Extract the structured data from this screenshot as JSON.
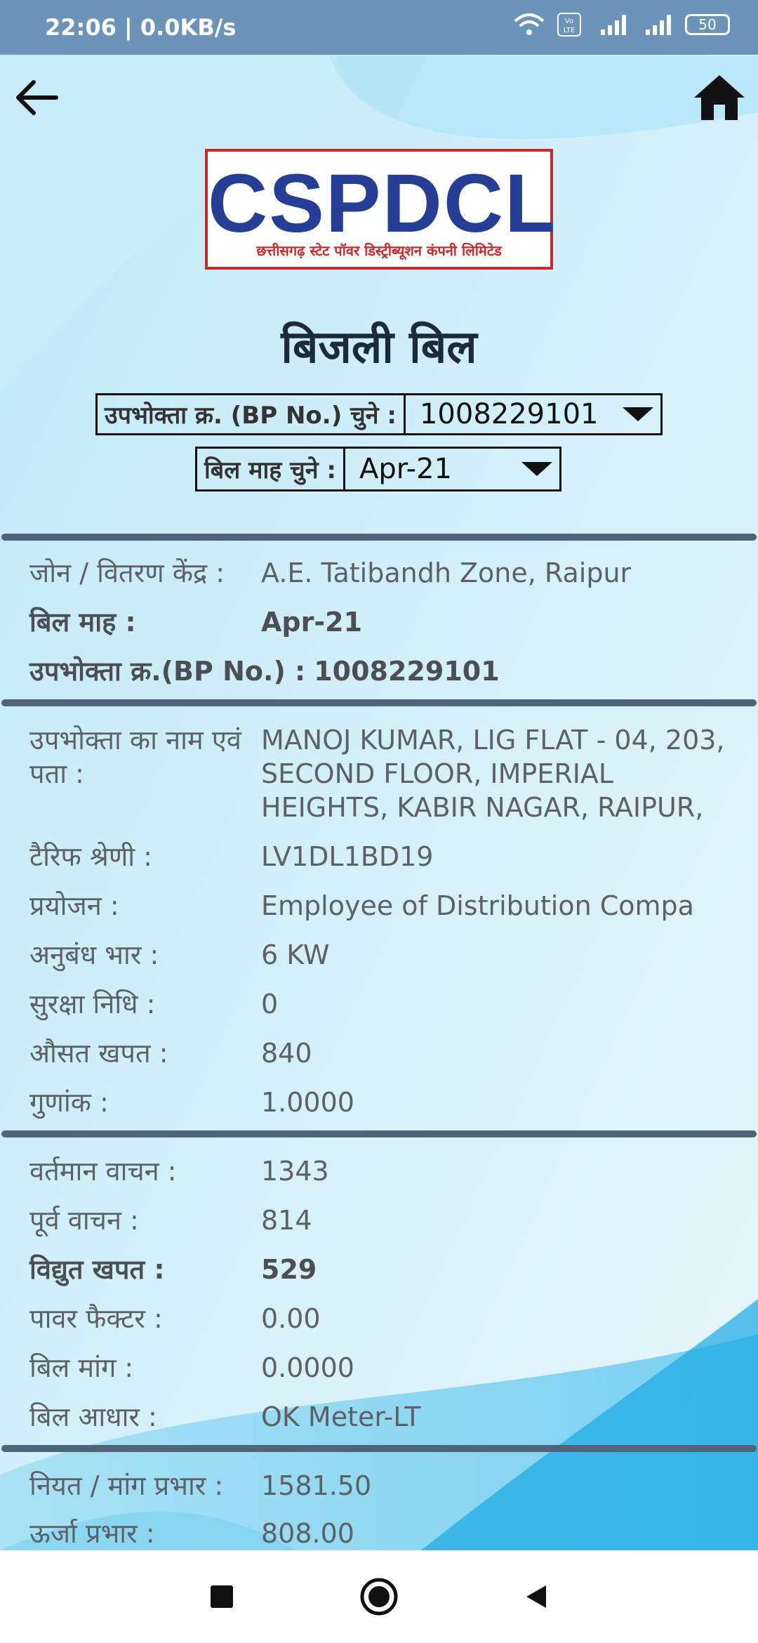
{
  "status_bar": {
    "time": "22:06 | 0.0KB/s",
    "battery": "50"
  },
  "header": {
    "back_icon": "arrow-left-icon",
    "home_icon": "home-icon",
    "logo_text": "CSPDCL",
    "logo_tagline": "छत्तीसगढ़ स्टेट पॉवर डिस्ट्रीब्यूशन कंपनी लिमिटेड",
    "title": "बिजली बिल"
  },
  "selectors": {
    "bp_label": "उपभोक्ता क्र. (BP No.) चुने :",
    "bp_value": "1008229101",
    "month_label": "बिल माह चुने :",
    "month_value": "Apr-21"
  },
  "section1": [
    {
      "key": "जोन / वितरण केंद्र :",
      "value": "A.E. Tatibandh Zone, Raipur",
      "bold": false
    },
    {
      "key": "बिल माह :",
      "value": "Apr-21",
      "bold": true
    },
    {
      "key": "उपभोक्ता क्र.(BP No.) :",
      "value": "1008229101",
      "bold": true
    }
  ],
  "section2": [
    {
      "key": "उपभोक्ता का नाम एवं पता :",
      "value": "MANOJ  KUMAR, LIG FLAT - 04, 203, SECOND FLOOR, IMPERIAL HEIGHTS, KABIR NAGAR, RAIPUR,"
    },
    {
      "key": "टैरिफ श्रेणी :",
      "value": "LV1DL1BD19"
    },
    {
      "key": "प्रयोजन :",
      "value": "Employee of Distribution Compa"
    },
    {
      "key": "अनुबंध भार :",
      "value": "6 KW"
    },
    {
      "key": "सुरक्षा निधि :",
      "value": "0"
    },
    {
      "key": "औसत खपत :",
      "value": "840"
    },
    {
      "key": "गुणांक :",
      "value": "1.0000"
    }
  ],
  "section3": [
    {
      "key": "वर्तमान वाचन :",
      "value": "1343"
    },
    {
      "key": "पूर्व वाचन :",
      "value": "814"
    },
    {
      "key": "विद्युत खपत :",
      "value": "529"
    },
    {
      "key": "पावर फैक्टर :",
      "value": "0.00"
    },
    {
      "key": "बिल मांग :",
      "value": "0.0000"
    },
    {
      "key": "बिल आधार :",
      "value": "OK Meter-LT"
    }
  ],
  "section4": [
    {
      "key": "नियत / मांग प्रभार :",
      "value": "1581.50"
    },
    {
      "key": "ऊर्जा प्रभार :",
      "value": "808.00"
    }
  ],
  "nav": {
    "recents_icon": "square-icon",
    "home_icon": "circle-icon",
    "back_icon": "triangle-back-icon"
  }
}
